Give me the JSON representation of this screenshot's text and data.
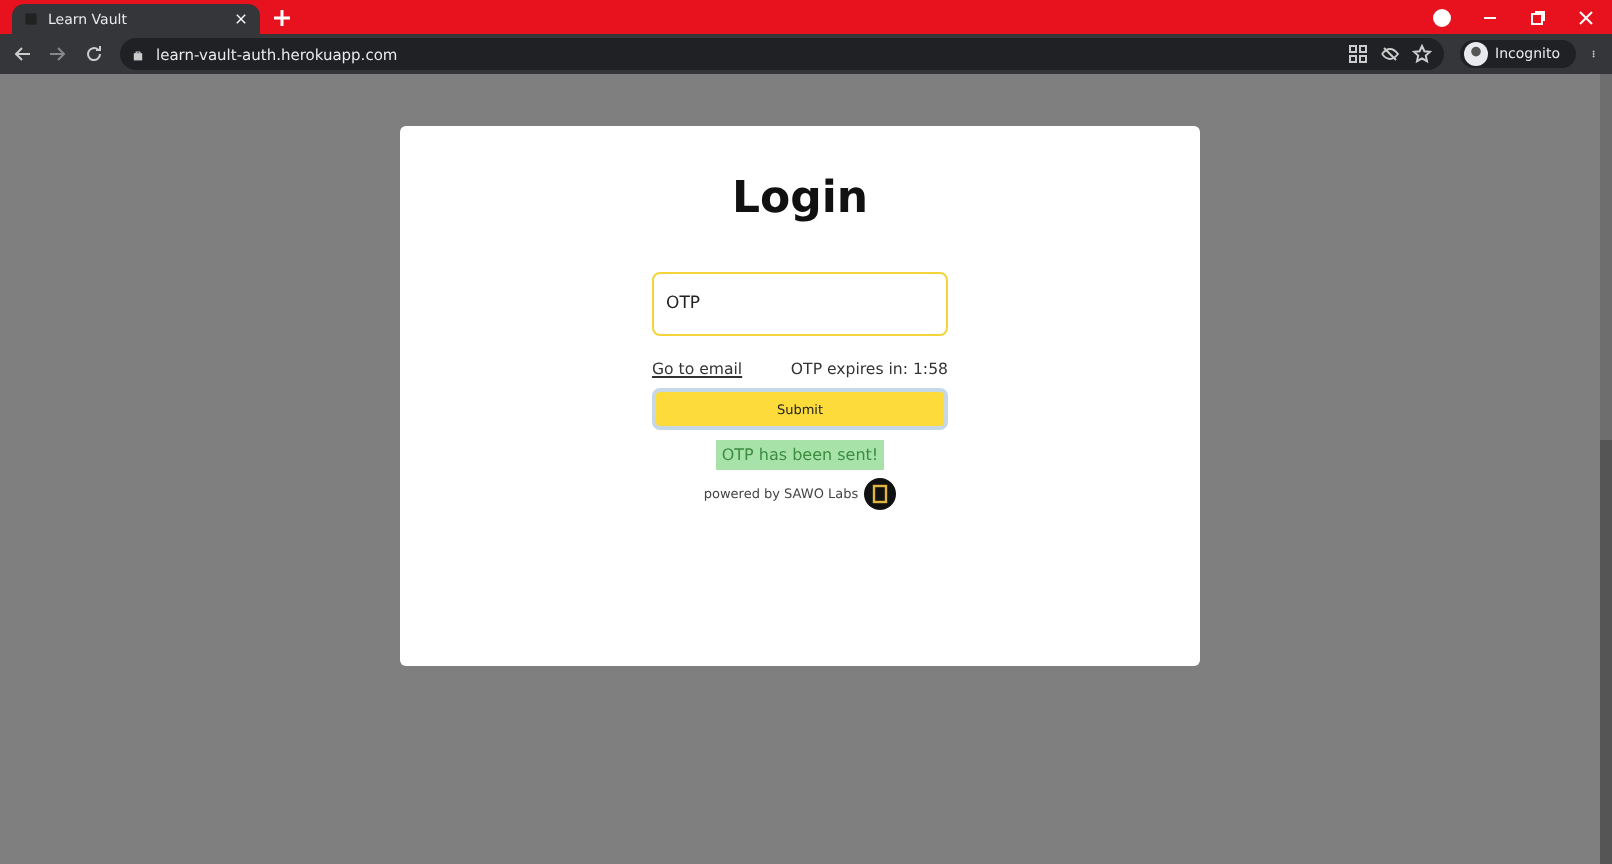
{
  "browser": {
    "tab_title": "Learn Vault",
    "url": "learn-vault-auth.herokuapp.com",
    "profile": "Incognito"
  },
  "login": {
    "title": "Login",
    "otp_field": {
      "placeholder": "OTP"
    },
    "go_to_email": "Go to email",
    "expiry": "OTP expires in: 1:58",
    "submit": "Submit",
    "notice": "OTP has been sent!",
    "powered_by": "powered by SAWO Labs"
  }
}
